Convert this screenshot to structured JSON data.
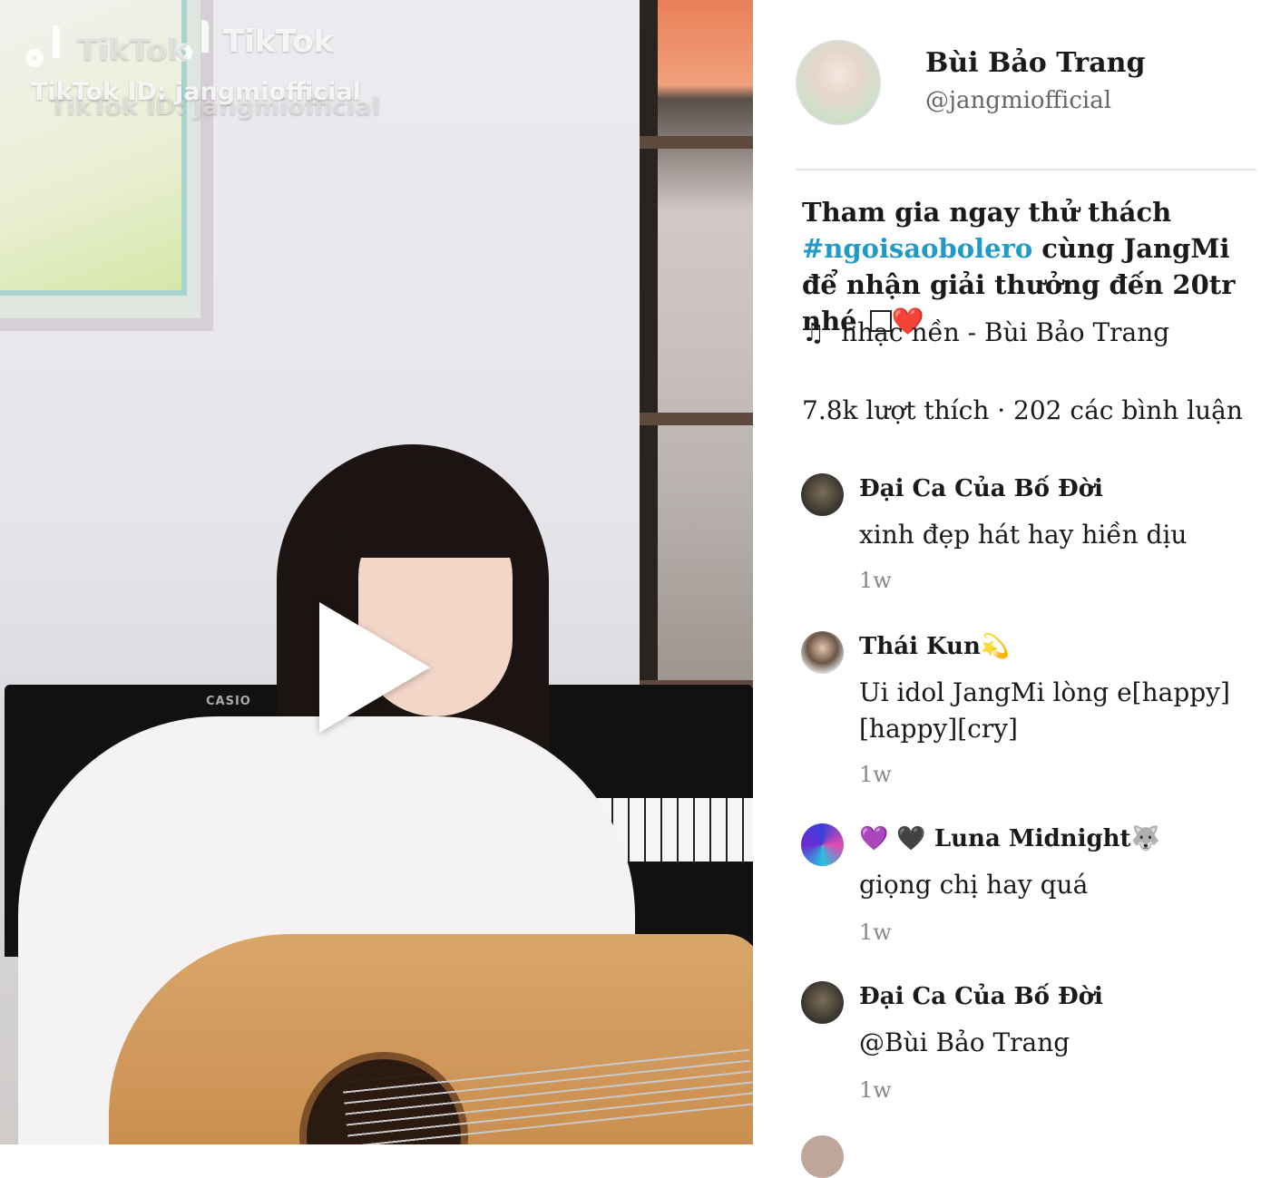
{
  "video": {
    "watermark_brand": "TikTok",
    "watermark_id": "TikTok ID: jangmiofficial",
    "keyboard_brand": "CASIO"
  },
  "profile": {
    "name": "Bùi Bảo Trang",
    "handle": "@jangmiofficial"
  },
  "post": {
    "caption_line1": "Tham gia ngay thử thách",
    "hashtag": "#ngoisaobolero",
    "caption_line2": " cùng JangMi để nhận giải thưởng đến 20tr nhé ",
    "emoji_heart": "❤️",
    "music_icon": "♫",
    "music": "nhạc nền - Bùi Bảo Trang",
    "stats": "7.8k lượt thích · 202 các bình luận"
  },
  "comments": [
    {
      "name": "Đại Ca Của Bố Đời",
      "text": "xinh đẹp hát hay hiền dịu",
      "time": "1w"
    },
    {
      "name": "Thái Kun💫",
      "text": "Ui idol JangMi lòng e[happy][happy][cry]",
      "time": "1w"
    },
    {
      "name": "💜 🖤 Luna Midnight🐺",
      "text": "giọng chị hay quá",
      "time": "1w"
    },
    {
      "name": "Đại Ca Của Bố Đời",
      "text": "@Bùi Bảo Trang",
      "time": "1w"
    }
  ]
}
